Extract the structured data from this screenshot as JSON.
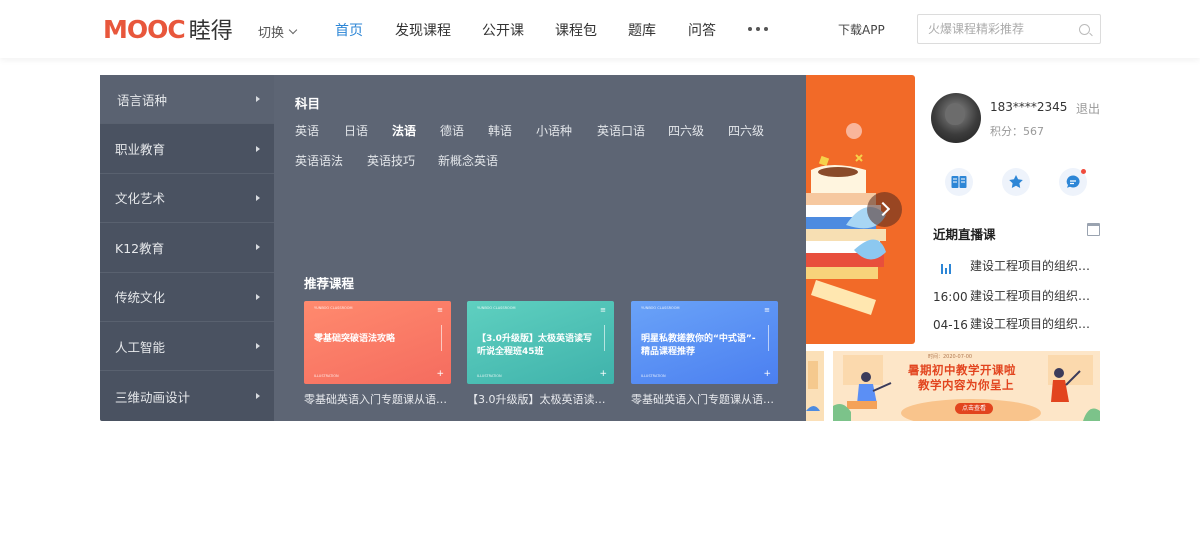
{
  "brand": {
    "logo_mark": "MOOC",
    "logo_text": "睦得",
    "accent_color": "#e8573c"
  },
  "header": {
    "switch_label": "切换",
    "nav": [
      {
        "label": "首页",
        "active": true
      },
      {
        "label": "发现课程",
        "active": false
      },
      {
        "label": "公开课",
        "active": false
      },
      {
        "label": "课程包",
        "active": false
      },
      {
        "label": "题库",
        "active": false
      },
      {
        "label": "问答",
        "active": false
      }
    ],
    "more_icon": "more-dots-icon",
    "download_label": "下载APP",
    "search_placeholder": "火爆课程精彩推荐",
    "active_color": "#2d86d6"
  },
  "categories": [
    {
      "label": "语言语种",
      "active": true
    },
    {
      "label": "职业教育",
      "active": false
    },
    {
      "label": "文化艺术",
      "active": false
    },
    {
      "label": "K12教育",
      "active": false
    },
    {
      "label": "传统文化",
      "active": false
    },
    {
      "label": "人工智能",
      "active": false
    },
    {
      "label": "三维动画设计",
      "active": false
    }
  ],
  "subpanel": {
    "title": "科目",
    "tags_row1": [
      {
        "label": "英语",
        "bold": false
      },
      {
        "label": "日语",
        "bold": false
      },
      {
        "label": "法语",
        "bold": true
      },
      {
        "label": "德语",
        "bold": false
      },
      {
        "label": "韩语",
        "bold": false
      },
      {
        "label": "小语种",
        "bold": false
      },
      {
        "label": "英语口语",
        "bold": false
      },
      {
        "label": "四六级",
        "bold": false
      },
      {
        "label": "四六级",
        "bold": false
      }
    ],
    "tags_row2": [
      {
        "label": "英语语法",
        "bold": false
      },
      {
        "label": "英语技巧",
        "bold": false
      },
      {
        "label": "新概念英语",
        "bold": false
      }
    ],
    "recommend_title": "推荐课程",
    "recommend": [
      {
        "thumb_text": "零基础突破语法攻略",
        "thumb_label": "YUNBOO\nCLASSROOM",
        "thumb_foot": "ILLUSTRATION",
        "name": "零基础英语入门专题课从语法...",
        "color": "#fa7a6a"
      },
      {
        "thumb_text": "【3.0升级版】太极英语读写听说全程班45班",
        "thumb_label": "YUNBOO\nCLASSROOM",
        "thumb_foot": "ILLUSTRATION",
        "name": "【3.0升级版】太极英语读写...",
        "color": "#4fc2b5"
      },
      {
        "thumb_text": "明星私教搓教你的“中式语”- 精品课程推荐",
        "thumb_label": "YUNBOO\nCLASSROOM",
        "thumb_foot": "ILLUSTRATION",
        "name": "零基础英语入门专题课从语法...",
        "color": "#5b8ff5"
      }
    ]
  },
  "carousel": {
    "bg_color": "#f26a28",
    "next_icon": "chevron-right-icon"
  },
  "user": {
    "name": "183****2345",
    "logout": "退出",
    "points": "积分：567",
    "quick_icons": [
      "course-book-icon",
      "favorite-star-icon",
      "message-icon"
    ]
  },
  "live": {
    "title": "近期直播课",
    "calendar_icon": "calendar-icon",
    "items": [
      {
        "time": "",
        "text": "建设工程项目的组织与...",
        "playing": true
      },
      {
        "time": "16:00",
        "text": "建设工程项目的组织与...",
        "playing": false
      },
      {
        "time": "04-16",
        "text": "建设工程项目的组织与...",
        "playing": false
      }
    ]
  },
  "banner": {
    "title_line1": "暑期初中教学开课啦",
    "title_line2": "教学内容为你呈上",
    "button": "点击查看",
    "date": "时间：2020-07-00"
  }
}
